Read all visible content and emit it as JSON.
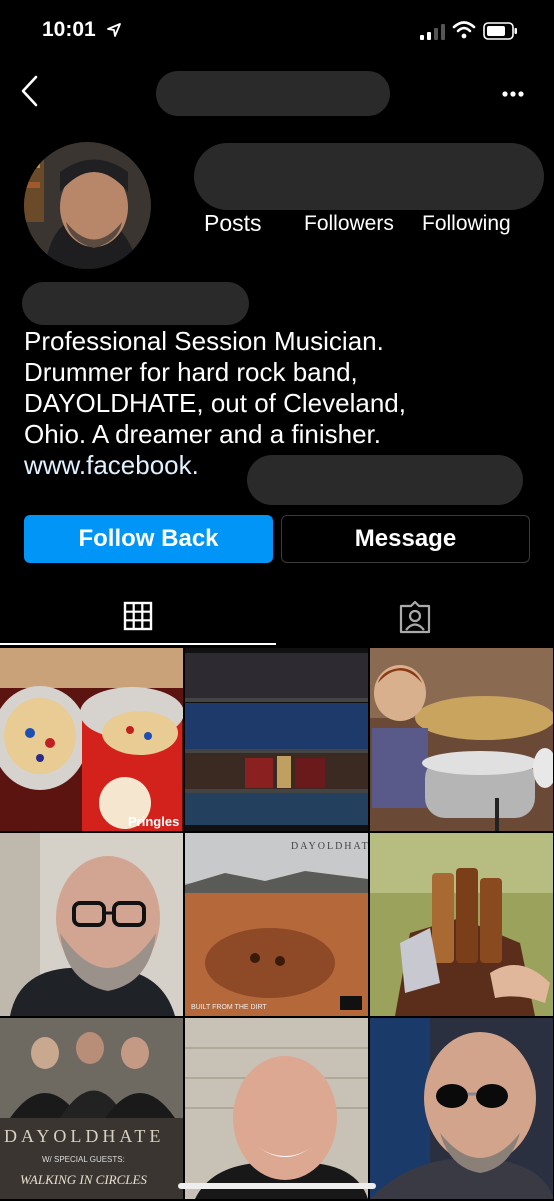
{
  "status_bar": {
    "time": "10:01"
  },
  "profile": {
    "stats": {
      "posts_label": "Posts",
      "followers_label": "Followers",
      "following_label": "Following"
    },
    "bio_lines": [
      "Professional Session Musician.",
      "Drummer for hard rock band,",
      "DAYOLDHATE, out of Cleveland,",
      "Ohio. A dreamer and a finisher."
    ],
    "link_text": "www.facebook."
  },
  "actions": {
    "follow_label": "Follow Back",
    "message_label": "Message"
  },
  "tabs": {
    "grid_icon": "grid-icon",
    "tagged_icon": "tagged-icon"
  },
  "posts": {
    "album_band_name": "DAYOLDHATE",
    "album_band_name_2": "DAYOLDHATE",
    "album_subtitle": "W/ SPECIAL GUESTS:",
    "album_guest": "WALKING IN CIRCLES",
    "album_caption": "BUILT FROM THE DIRT",
    "snack_brand": "Pringles"
  },
  "colors": {
    "accent": "#0095f6",
    "background": "#000000"
  }
}
